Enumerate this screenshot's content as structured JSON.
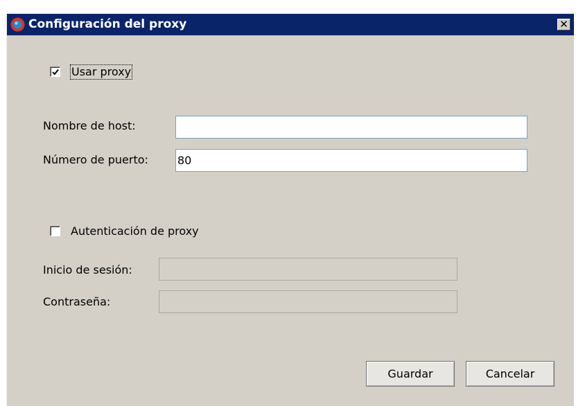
{
  "window": {
    "title": "Configuración del proxy",
    "close_glyph": "✕"
  },
  "colors": {
    "titlebar": "#0a246a",
    "dialog_bg": "#d4d0c8",
    "icon_red": "#d9332b",
    "icon_blue": "#1e90c8"
  },
  "icons": {
    "app": "app-logo-icon",
    "close": "close-icon",
    "check": "check-icon"
  },
  "use_proxy": {
    "label": "Usar proxy",
    "checked": true
  },
  "host": {
    "label": "Nombre de host:",
    "value": ""
  },
  "port": {
    "label": "Número de puerto:",
    "value": "80"
  },
  "auth": {
    "label": "Autenticación de proxy",
    "checked": false
  },
  "login": {
    "label": "Inicio de sesión:",
    "value": ""
  },
  "password": {
    "label": "Contraseña:",
    "value": ""
  },
  "buttons": {
    "save": "Guardar",
    "cancel": "Cancelar"
  }
}
